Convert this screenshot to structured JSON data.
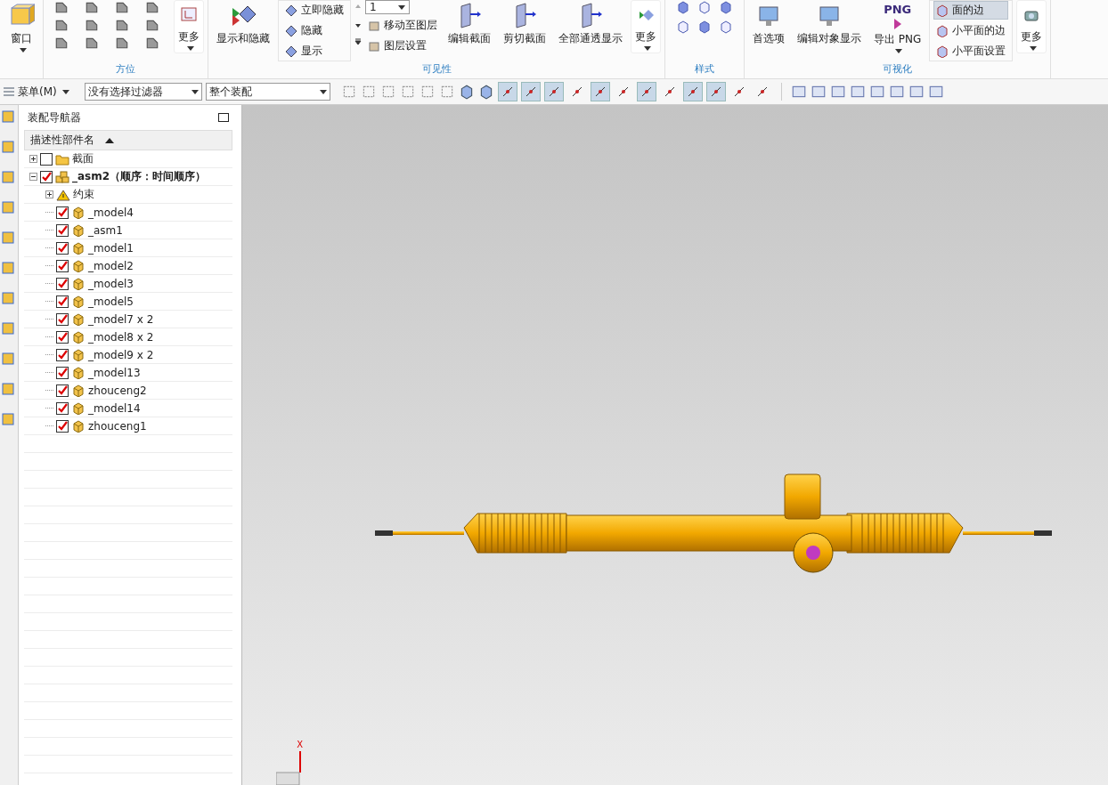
{
  "ribbon": {
    "window_button": "窗口",
    "orientation_group": {
      "label": "方位",
      "more": "更多"
    },
    "visibility_group": {
      "label": "可见性",
      "show_hide": "显示和隐藏",
      "list": [
        "立即隐藏",
        "隐藏",
        "显示"
      ],
      "layer": "1",
      "layer_actions": [
        "移动至图层",
        "图层设置"
      ],
      "buttons": [
        "编辑截面",
        "剪切截面",
        "全部通透显示"
      ],
      "more": "更多"
    },
    "style_group": {
      "label": "样式"
    },
    "visualization_group": {
      "label": "可视化",
      "buttons": [
        "首选项",
        "编辑对象显示"
      ],
      "png_badge": "PNG",
      "export": "导出 PNG",
      "edge_options": [
        {
          "label": "面的边",
          "selected": true
        },
        {
          "label": "小平面的边",
          "selected": false
        },
        {
          "label": "小平面设置",
          "selected": false
        }
      ],
      "more": "更多"
    }
  },
  "toolbar": {
    "menu": "菜单(M)",
    "filter": "没有选择过滤器",
    "scope": "整个装配",
    "snap_buttons": [
      {
        "selected": true
      },
      {
        "selected": true
      },
      {
        "selected": true
      },
      {
        "selected": false
      },
      {
        "selected": true
      },
      {
        "selected": false
      },
      {
        "selected": true
      },
      {
        "selected": false
      },
      {
        "selected": true
      },
      {
        "selected": true
      },
      {
        "selected": false
      },
      {
        "selected": false
      }
    ]
  },
  "navigator": {
    "title": "装配导航器",
    "column": "描述性部件名",
    "tree": [
      {
        "label": "截面",
        "kind": "folder",
        "checked": false,
        "expanded": false
      },
      {
        "label": "_asm2（顺序：时间顺序）",
        "kind": "assembly",
        "checked": true,
        "expanded": true,
        "children": [
          {
            "label": "约束",
            "kind": "constraints",
            "expanded": false
          },
          {
            "label": "_model4",
            "kind": "part",
            "checked": true
          },
          {
            "label": "_asm1",
            "kind": "part",
            "checked": true
          },
          {
            "label": "_model1",
            "kind": "part",
            "checked": true
          },
          {
            "label": "_model2",
            "kind": "part",
            "checked": true
          },
          {
            "label": "_model3",
            "kind": "part",
            "checked": true
          },
          {
            "label": "_model5",
            "kind": "part",
            "checked": true
          },
          {
            "label": "_model7 x 2",
            "kind": "part",
            "checked": true
          },
          {
            "label": "_model8 x 2",
            "kind": "part",
            "checked": true
          },
          {
            "label": "_model9 x 2",
            "kind": "part",
            "checked": true
          },
          {
            "label": "_model13",
            "kind": "part",
            "checked": true
          },
          {
            "label": "zhouceng2",
            "kind": "part",
            "checked": true
          },
          {
            "label": "_model14",
            "kind": "part",
            "checked": true
          },
          {
            "label": "zhouceng1",
            "kind": "part",
            "checked": true
          }
        ]
      }
    ]
  },
  "viewport": {
    "axis_label": "X"
  }
}
